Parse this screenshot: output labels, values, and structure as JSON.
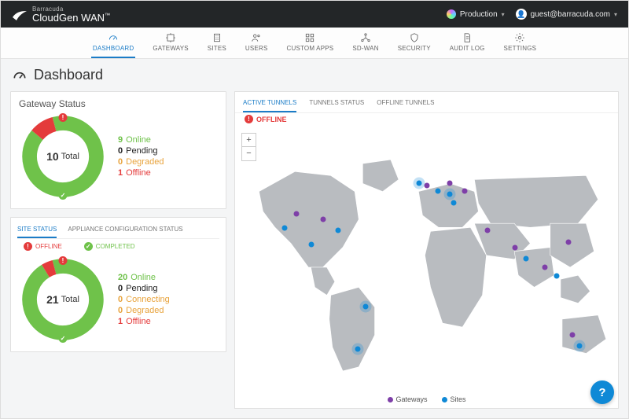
{
  "brand": {
    "vendor": "Barracuda",
    "product": "CloudGen WAN",
    "tm": "™"
  },
  "topbar": {
    "environment": "Production",
    "account": "guest@barracuda.com"
  },
  "nav": [
    {
      "id": "dashboard",
      "label": "DASHBOARD",
      "active": true
    },
    {
      "id": "gateways",
      "label": "GATEWAYS"
    },
    {
      "id": "sites",
      "label": "SITES"
    },
    {
      "id": "users",
      "label": "USERS"
    },
    {
      "id": "custom-apps",
      "label": "CUSTOM APPS"
    },
    {
      "id": "sd-wan",
      "label": "SD-WAN"
    },
    {
      "id": "security",
      "label": "SECURITY"
    },
    {
      "id": "audit-log",
      "label": "AUDIT LOG"
    },
    {
      "id": "settings",
      "label": "SETTINGS"
    }
  ],
  "page_title": "Dashboard",
  "gateway_status": {
    "title": "Gateway Status",
    "total_value": "10",
    "total_label": "Total",
    "legend": [
      {
        "value": "9",
        "label": "Online",
        "color": "c-green"
      },
      {
        "value": "0",
        "label": "Pending",
        "color": "c-black"
      },
      {
        "value": "0",
        "label": "Degraded",
        "color": "c-orange"
      },
      {
        "value": "1",
        "label": "Offline",
        "color": "c-red"
      }
    ]
  },
  "site_card": {
    "tabs": [
      {
        "id": "site-status",
        "label": "SITE STATUS",
        "active": true,
        "badge": "red",
        "badge_text": "OFFLINE"
      },
      {
        "id": "appl-config",
        "label": "APPLIANCE CONFIGURATION STATUS",
        "badge": "green",
        "badge_text": "COMPLETED"
      }
    ],
    "total_value": "21",
    "total_label": "Total",
    "legend": [
      {
        "value": "20",
        "label": "Online",
        "color": "c-green"
      },
      {
        "value": "0",
        "label": "Pending",
        "color": "c-black"
      },
      {
        "value": "0",
        "label": "Connecting",
        "color": "c-orange"
      },
      {
        "value": "0",
        "label": "Degraded",
        "color": "c-orange"
      },
      {
        "value": "1",
        "label": "Offline",
        "color": "c-red"
      }
    ]
  },
  "map": {
    "tabs": [
      {
        "id": "active-tunnels",
        "label": "ACTIVE TUNNELS",
        "active": true
      },
      {
        "id": "tunnels-status",
        "label": "TUNNELS STATUS"
      },
      {
        "id": "offline-tunnels",
        "label": "OFFLINE TUNNELS"
      }
    ],
    "offline_label": "OFFLINE",
    "legend": {
      "gateways": "Gateways",
      "sites": "Sites"
    },
    "zoom": {
      "in": "+",
      "out": "−"
    }
  },
  "chart_data": [
    {
      "type": "pie",
      "title": "Gateway Status",
      "total": 10,
      "series": [
        {
          "name": "Online",
          "value": 9,
          "color": "#6fc24a"
        },
        {
          "name": "Pending",
          "value": 0,
          "color": "#222222"
        },
        {
          "name": "Degraded",
          "value": 0,
          "color": "#e8a33c"
        },
        {
          "name": "Offline",
          "value": 1,
          "color": "#e43b3b"
        }
      ]
    },
    {
      "type": "pie",
      "title": "Site Status",
      "total": 21,
      "series": [
        {
          "name": "Online",
          "value": 20,
          "color": "#6fc24a"
        },
        {
          "name": "Pending",
          "value": 0,
          "color": "#222222"
        },
        {
          "name": "Connecting",
          "value": 0,
          "color": "#e8a33c"
        },
        {
          "name": "Degraded",
          "value": 0,
          "color": "#e8a33c"
        },
        {
          "name": "Offline",
          "value": 1,
          "color": "#e43b3b"
        }
      ]
    }
  ]
}
